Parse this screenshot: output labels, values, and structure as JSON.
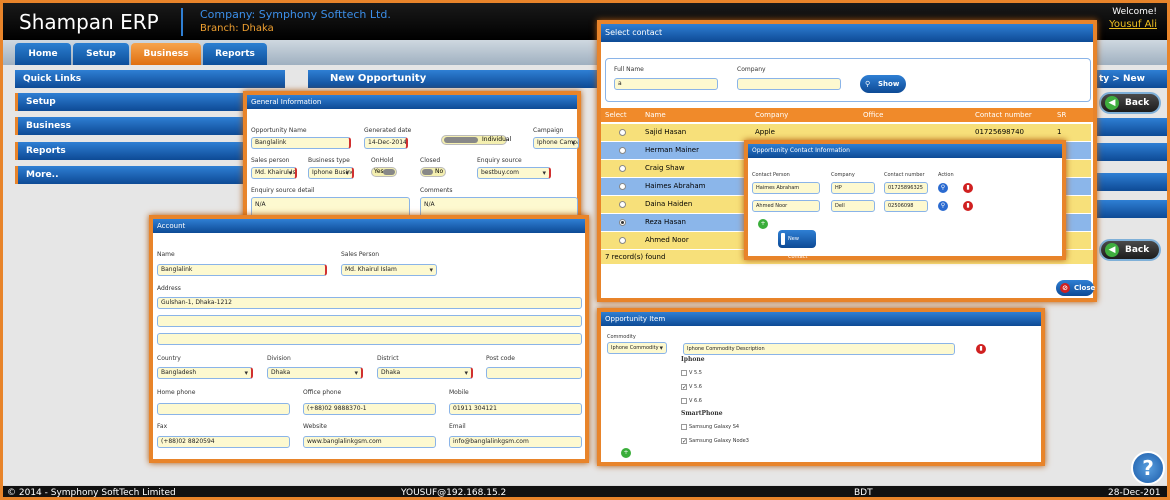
{
  "header": {
    "app_title": "Shampan ERP",
    "company": "Company: Symphony Softtech Ltd.",
    "branch": "Branch: Dhaka",
    "welcome": "Welcome!",
    "user": "Yousuf Ali"
  },
  "nav": {
    "tabs": [
      {
        "label": "Home"
      },
      {
        "label": "Setup"
      },
      {
        "label": "Business"
      },
      {
        "label": "Reports"
      }
    ]
  },
  "quick_links": {
    "title": "Quick Links",
    "items": [
      "Setup",
      "Business",
      "Reports",
      "More.."
    ]
  },
  "page": {
    "title": "New Opportunity",
    "breadcrumb": "ty > New",
    "back_label": "Back"
  },
  "general": {
    "title": "General Information",
    "opp_name_label": "Opportunity Name",
    "opp_name": "Banglalink",
    "gen_date_label": "Generated date",
    "gen_date": "14-Dec-2014",
    "individual_label": "Individual",
    "campaign_label": "Campaign",
    "campaign": "Iphone Campaign",
    "sales_label": "Sales person",
    "sales": "Md. Khairul Islam",
    "btype_label": "Business type",
    "btype": "Iphone Business",
    "onhold_label": "OnHold",
    "onhold": "Yes",
    "closed_label": "Closed",
    "closed": "No",
    "esource_label": "Enquiry source",
    "esource": "bestbuy.com",
    "esdetail_label": "Enquiry source detail",
    "esdetail": "N/A",
    "comments_label": "Comments",
    "comments": "N/A"
  },
  "account": {
    "title": "Account",
    "name_label": "Name",
    "name": "Banglalink",
    "sales_label": "Sales Person",
    "sales": "Md. Khairul Islam",
    "address_label": "Address",
    "address": "Gulshan-1, Dhaka-1212",
    "country_label": "Country",
    "country": "Bangladesh",
    "division_label": "Division",
    "division": "Dhaka",
    "district_label": "District",
    "district": "Dhaka",
    "postcode_label": "Post code",
    "homephone_label": "Home phone",
    "officephone_label": "Office phone",
    "officephone": "(+88)02 9888370-1",
    "mobile_label": "Mobile",
    "mobile": "01911 304121",
    "fax_label": "Fax",
    "fax": "(+88)02 8820594",
    "website_label": "Website",
    "website": "www.banglalinkgsm.com",
    "email_label": "Email",
    "email": "info@banglalinkgsm.com"
  },
  "select_contact": {
    "title": "Select contact",
    "fullname_label": "Full Name",
    "fullname": "a",
    "company_label": "Company",
    "show_label": "Show",
    "columns": [
      "Select",
      "Name",
      "Company",
      "Office",
      "Contact number",
      "SR"
    ],
    "rows": [
      {
        "name": "Sajid Hasan",
        "company": "Apple",
        "office": "",
        "contact": "01725698740",
        "sr": "1"
      },
      {
        "name": "Herman Mainer",
        "company": "",
        "office": "",
        "contact": "",
        "sr": ""
      },
      {
        "name": "Craig Shaw",
        "company": "",
        "office": "",
        "contact": "",
        "sr": ""
      },
      {
        "name": "Haimes Abraham",
        "company": "",
        "office": "",
        "contact": "",
        "sr": ""
      },
      {
        "name": "Daina Haiden",
        "company": "",
        "office": "",
        "contact": "",
        "sr": ""
      },
      {
        "name": "Reza Hasan",
        "company": "",
        "office": "",
        "contact": "",
        "sr": ""
      },
      {
        "name": "Ahmed Noor",
        "company": "",
        "office": "",
        "contact": "",
        "sr": ""
      }
    ],
    "found": "7 record(s) found",
    "close_label": "Close"
  },
  "opp_contact": {
    "title": "Opportunity Contact Information",
    "col_person": "Contact Person",
    "col_company": "Company",
    "col_number": "Contact number",
    "col_action": "Action",
    "rows": [
      {
        "person": "Haimes Abraham",
        "company": "HP",
        "number": "01725896325"
      },
      {
        "person": "Ahmed Noor",
        "company": "Dell",
        "number": "02506098"
      }
    ],
    "new_label": "New Contact"
  },
  "opp_item": {
    "title": "Opportunity Item",
    "commodity_label": "Commodity",
    "commodity": "Iphone Commodity",
    "description": "Iphone Commodity Description",
    "group1": "Iphone",
    "group1_items": [
      {
        "label": "V 5.5",
        "checked": false
      },
      {
        "label": "V 5.6",
        "checked": true
      },
      {
        "label": "V 6.6",
        "checked": false
      }
    ],
    "group2": "SmartPhone",
    "group2_items": [
      {
        "label": "Samsung Galaxy S4",
        "checked": false
      },
      {
        "label": "Samsung Galaxy Node3",
        "checked": true
      }
    ]
  },
  "footer": {
    "copyright": "© 2014 - Symphony SoftTech Limited",
    "user_ip": "YOUSUF@192.168.15.2",
    "currency": "BDT",
    "date": "28-Dec-201"
  }
}
